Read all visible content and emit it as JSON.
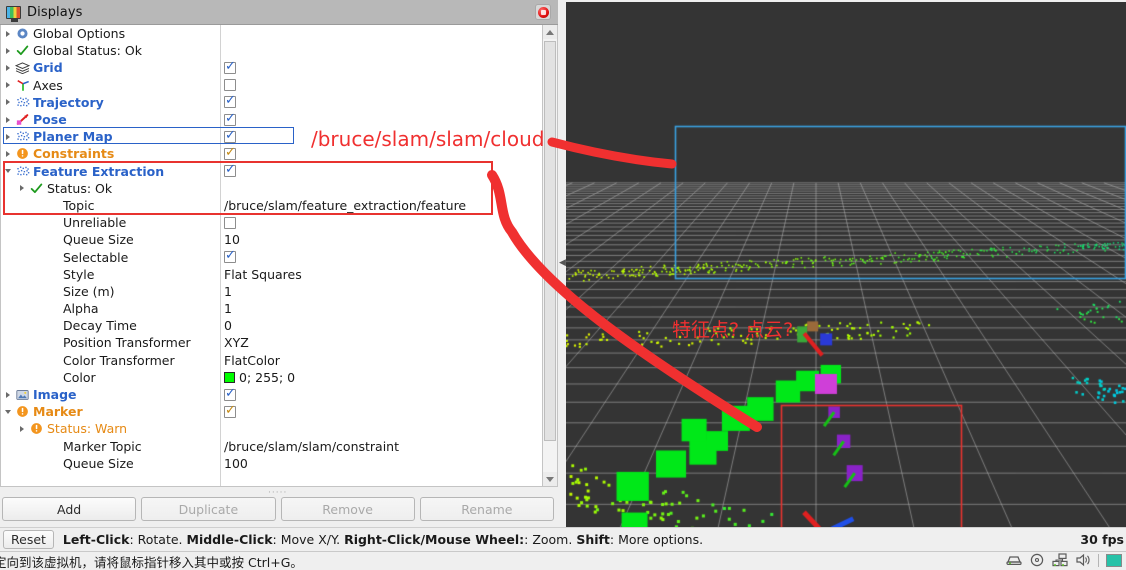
{
  "panel": {
    "title": "Displays",
    "icon": "monitor-icon",
    "close_icon": "close-icon"
  },
  "tree": {
    "rows": [
      {
        "id": "global-options",
        "arrow": "right",
        "icon": "gear-icon",
        "label": "Global Options",
        "style": "plain",
        "indent": 0,
        "value": "",
        "value_type": "none"
      },
      {
        "id": "global-status",
        "arrow": "right",
        "icon": "check-icon",
        "label": "Global Status: Ok",
        "style": "plain",
        "indent": 0,
        "value": "",
        "value_type": "none"
      },
      {
        "id": "grid",
        "arrow": "right",
        "icon": "grid-icon",
        "label": "Grid",
        "style": "bold-blue",
        "indent": 0,
        "value": "checked",
        "value_type": "checkbox"
      },
      {
        "id": "axes",
        "arrow": "right",
        "icon": "axes-icon",
        "label": "Axes",
        "style": "plain",
        "indent": 0,
        "value": "unchecked",
        "value_type": "checkbox"
      },
      {
        "id": "trajectory",
        "arrow": "right",
        "icon": "pointcloud-icon",
        "label": "Trajectory",
        "style": "bold-blue",
        "indent": 0,
        "value": "checked",
        "value_type": "checkbox"
      },
      {
        "id": "pose",
        "arrow": "right",
        "icon": "pose-icon",
        "label": "Pose",
        "style": "bold-blue",
        "indent": 0,
        "value": "checked",
        "value_type": "checkbox"
      },
      {
        "id": "planer-map",
        "arrow": "right",
        "icon": "pointcloud-icon",
        "label": "Planer Map",
        "style": "bold-blue",
        "indent": 0,
        "value": "checked",
        "value_type": "checkbox"
      },
      {
        "id": "constraints",
        "arrow": "right",
        "icon": "warn-icon",
        "label": "Constraints",
        "style": "bold-orange",
        "indent": 0,
        "value": "checked",
        "value_type": "checkbox-orange"
      },
      {
        "id": "feature-extraction",
        "arrow": "down",
        "icon": "pointcloud-icon",
        "label": "Feature Extraction",
        "style": "bold-blue",
        "indent": 0,
        "value": "checked",
        "value_type": "checkbox"
      },
      {
        "id": "fe-status",
        "arrow": "right",
        "icon": "check-icon",
        "label": "Status: Ok",
        "style": "plain",
        "indent": 1,
        "value": "",
        "value_type": "none"
      },
      {
        "id": "fe-topic",
        "arrow": "none",
        "icon": "none",
        "label": "Topic",
        "style": "plain",
        "indent": 2,
        "value": "/bruce/slam/feature_extraction/feature",
        "value_type": "text"
      },
      {
        "id": "fe-unreliable",
        "arrow": "none",
        "icon": "none",
        "label": "Unreliable",
        "style": "plain",
        "indent": 2,
        "value": "unchecked",
        "value_type": "checkbox"
      },
      {
        "id": "fe-queue-size",
        "arrow": "none",
        "icon": "none",
        "label": "Queue Size",
        "style": "plain",
        "indent": 2,
        "value": "10",
        "value_type": "text"
      },
      {
        "id": "fe-selectable",
        "arrow": "none",
        "icon": "none",
        "label": "Selectable",
        "style": "plain",
        "indent": 2,
        "value": "checked",
        "value_type": "checkbox"
      },
      {
        "id": "fe-style",
        "arrow": "none",
        "icon": "none",
        "label": "Style",
        "style": "plain",
        "indent": 2,
        "value": "Flat Squares",
        "value_type": "text"
      },
      {
        "id": "fe-size",
        "arrow": "none",
        "icon": "none",
        "label": "Size (m)",
        "style": "plain",
        "indent": 2,
        "value": "1",
        "value_type": "text"
      },
      {
        "id": "fe-alpha",
        "arrow": "none",
        "icon": "none",
        "label": "Alpha",
        "style": "plain",
        "indent": 2,
        "value": "1",
        "value_type": "text"
      },
      {
        "id": "fe-decay",
        "arrow": "none",
        "icon": "none",
        "label": "Decay Time",
        "style": "plain",
        "indent": 2,
        "value": "0",
        "value_type": "text"
      },
      {
        "id": "fe-pos-transformer",
        "arrow": "none",
        "icon": "none",
        "label": "Position Transformer",
        "style": "plain",
        "indent": 2,
        "value": "XYZ",
        "value_type": "text"
      },
      {
        "id": "fe-color-transformer",
        "arrow": "none",
        "icon": "none",
        "label": "Color Transformer",
        "style": "plain",
        "indent": 2,
        "value": "FlatColor",
        "value_type": "text"
      },
      {
        "id": "fe-color",
        "arrow": "none",
        "icon": "none",
        "label": "Color",
        "style": "plain",
        "indent": 2,
        "value": "0; 255; 0",
        "value_type": "color",
        "swatch": "#00ff00"
      },
      {
        "id": "image",
        "arrow": "right",
        "icon": "image-icon",
        "label": "Image",
        "style": "bold-blue",
        "indent": 0,
        "value": "checked",
        "value_type": "checkbox"
      },
      {
        "id": "marker",
        "arrow": "down",
        "icon": "warn-icon",
        "label": "Marker",
        "style": "bold-orange",
        "indent": 0,
        "value": "checked",
        "value_type": "checkbox-orange"
      },
      {
        "id": "marker-status",
        "arrow": "right",
        "icon": "warn-icon",
        "label": "Status: Warn",
        "style": "warn-txt",
        "indent": 1,
        "value": "",
        "value_type": "none"
      },
      {
        "id": "marker-topic",
        "arrow": "none",
        "icon": "none",
        "label": "Marker Topic",
        "style": "plain",
        "indent": 2,
        "value": "/bruce/slam/slam/constraint",
        "value_type": "text"
      },
      {
        "id": "marker-queue-size",
        "arrow": "none",
        "icon": "none",
        "label": "Queue Size",
        "style": "plain",
        "indent": 2,
        "value": "100",
        "value_type": "text"
      }
    ]
  },
  "buttons": {
    "add": "Add",
    "duplicate": "Duplicate",
    "remove": "Remove",
    "rename": "Rename"
  },
  "help": {
    "reset": "Reset",
    "parts": [
      {
        "text": "Left-Click",
        "bold": true
      },
      {
        "text": ": Rotate. ",
        "bold": false
      },
      {
        "text": "Middle-Click",
        "bold": true
      },
      {
        "text": ": Move X/Y. ",
        "bold": false
      },
      {
        "text": "Right-Click/Mouse Wheel:",
        "bold": true
      },
      {
        "text": ": Zoom. ",
        "bold": false
      },
      {
        "text": "Shift",
        "bold": true
      },
      {
        "text": ": More options.",
        "bold": false
      }
    ],
    "fps": "30 fps"
  },
  "vm_status": {
    "text": "定向到该虚拟机，请将鼠标指针移入其中或按 Ctrl+G。",
    "tray_icons": [
      "hard-disk-icon",
      "cd-icon",
      "network-icon",
      "sound-icon",
      "screen-icon"
    ]
  },
  "annotations": {
    "topic_label": "/bruce/slam/slam/cloud",
    "question_label": "特征点? 点云?",
    "color": "#f03030",
    "box_blue_color": "#2a62c8",
    "box_red_color": "#e8332f"
  },
  "view3d": {
    "background": "#343434",
    "grid_color": "#b9b9b9",
    "selection_box_color": "#3aa0e0",
    "highlight_box_color": "#e8332f",
    "marker_color": "#00e818"
  }
}
